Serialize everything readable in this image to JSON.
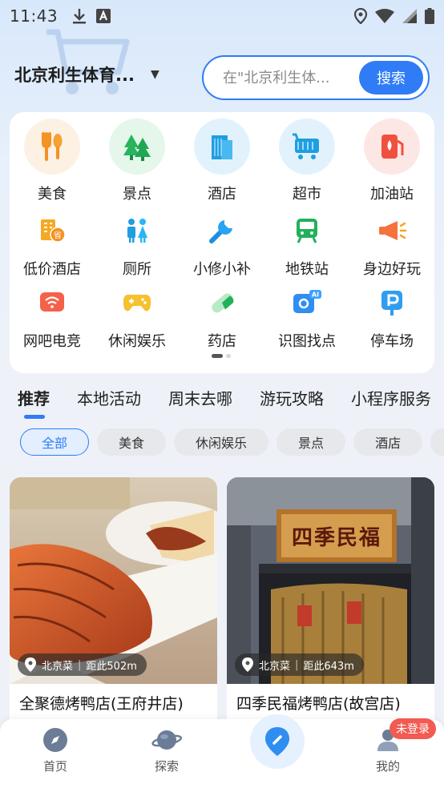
{
  "status_bar": {
    "time": "11:43"
  },
  "header": {
    "location": "北京利生体育...",
    "search_placeholder": "在\"北京利生体...",
    "search_button": "搜索"
  },
  "categories": {
    "row1": [
      "美食",
      "景点",
      "酒店",
      "超市",
      "加油站"
    ],
    "row2": [
      "低价酒店",
      "厕所",
      "小修小补",
      "地铁站",
      "身边好玩"
    ],
    "row3": [
      "网吧电竞",
      "休闲娱乐",
      "药店",
      "识图找点",
      "停车场"
    ]
  },
  "tabs": [
    "推荐",
    "本地活动",
    "周末去哪",
    "游玩攻略",
    "小程序服务"
  ],
  "chips": [
    "全部",
    "美食",
    "休闲娱乐",
    "景点",
    "酒店"
  ],
  "cards": [
    {
      "category": "北京菜",
      "distance": "距此502m",
      "title": "全聚德烤鸭店(王府井店)"
    },
    {
      "category": "北京菜",
      "distance": "距此643m",
      "title": "四季民福烤鸭店(故宫店)",
      "sign_text": "四季民福"
    }
  ],
  "bottom_nav": {
    "home": "首页",
    "explore": "探索",
    "me": "我的",
    "login_badge": "未登录"
  },
  "colors": {
    "accent": "#2f7cf6",
    "badge": "#f15b52"
  }
}
